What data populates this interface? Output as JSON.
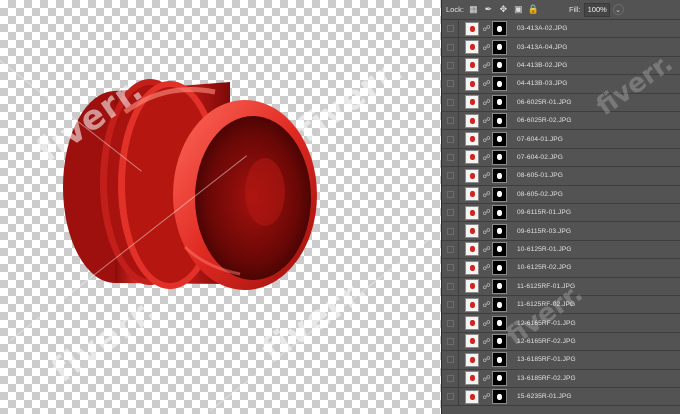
{
  "canvas": {
    "watermark": "fiverr."
  },
  "layers_panel": {
    "lock_label": "Lock:",
    "fill_label": "Fill:",
    "fill_value": "100%",
    "lock_icons": [
      "lock-transparent-pixels-icon",
      "lock-image-pixels-icon",
      "lock-position-icon",
      "lock-artboard-icon",
      "lock-all-icon"
    ],
    "layers": [
      {
        "name": "03-413A-02.JPG"
      },
      {
        "name": "03-413A-04.JPG"
      },
      {
        "name": "04-413B-02.JPG"
      },
      {
        "name": "04-413B-03.JPG"
      },
      {
        "name": "06-6025R-01.JPG"
      },
      {
        "name": "06-6025R-02.JPG"
      },
      {
        "name": "07-604-01.JPG"
      },
      {
        "name": "07-604-02.JPG"
      },
      {
        "name": "08-605-01.JPG"
      },
      {
        "name": "08-605-02.JPG"
      },
      {
        "name": "09-6115R-01.JPG"
      },
      {
        "name": "09-6115R-03.JPG"
      },
      {
        "name": "10-6125R-01.JPG"
      },
      {
        "name": "10-6125R-02.JPG"
      },
      {
        "name": "11-6125RF-01.JPG"
      },
      {
        "name": "11-6125RF-02.JPG"
      },
      {
        "name": "12-6165RF-01.JPG"
      },
      {
        "name": "12-6165RF-02.JPG"
      },
      {
        "name": "13-6185RF-01.JPG"
      },
      {
        "name": "13-6185RF-02.JPG"
      },
      {
        "name": "15-6235R-01.JPG"
      }
    ]
  },
  "colors": {
    "panel_bg": "#535353",
    "product_red": "#d1241f"
  }
}
